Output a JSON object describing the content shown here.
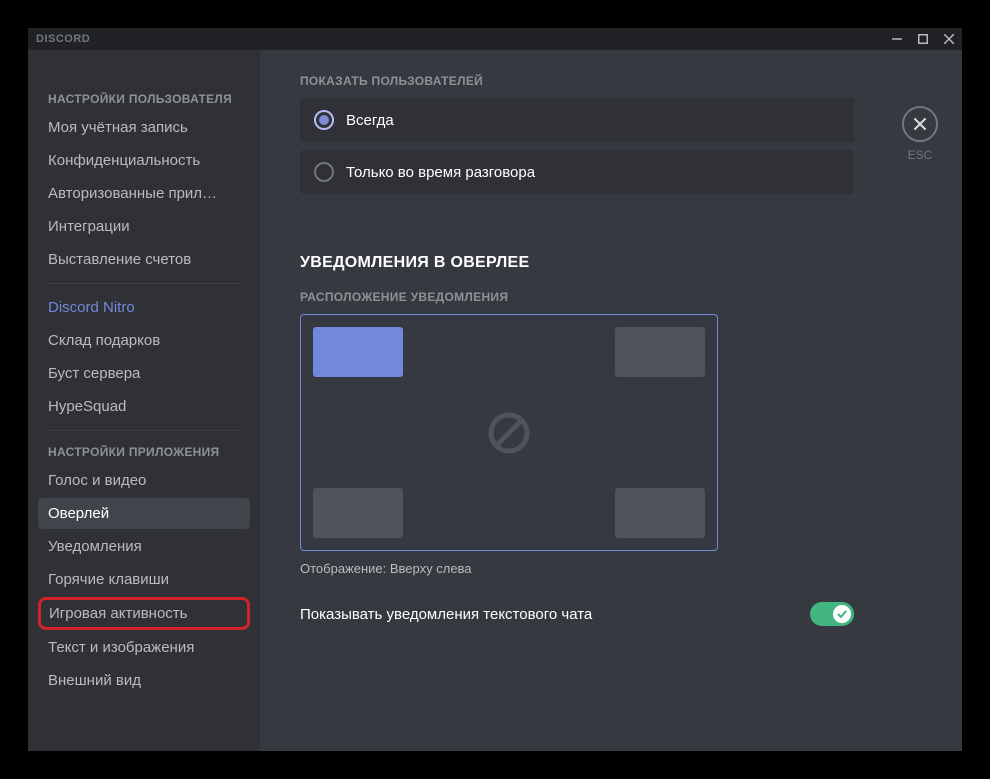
{
  "app": {
    "title": "DISCORD"
  },
  "esc": {
    "label": "ESC"
  },
  "sidebar": {
    "section_user": "НАСТРОЙКИ ПОЛЬЗОВАТЕЛЯ",
    "items_user": [
      "Моя учётная запись",
      "Конфиденциальность",
      "Авторизованные прил…",
      "Интеграции",
      "Выставление счетов"
    ],
    "nitro": "Discord Nitro",
    "after_nitro": [
      "Склад подарков",
      "Буст сервера",
      "HypeSquad"
    ],
    "section_app": "НАСТРОЙКИ ПРИЛОЖЕНИЯ",
    "items_app": [
      "Голос и видео",
      "Оверлей",
      "Уведомления",
      "Горячие клавиши",
      "Игровая активность",
      "Текст и изображения",
      "Внешний вид"
    ],
    "active": "Оверлей",
    "highlighted": "Игровая активность"
  },
  "main": {
    "show_users_header": "ПОКАЗАТЬ ПОЛЬЗОВАТЕЛЕЙ",
    "radio_always": "Всегда",
    "radio_talking": "Только во время разговора",
    "overlay_notify_title": "УВЕДОМЛЕНИЯ В ОВЕРЛЕЕ",
    "position_header": "РАСПОЛОЖЕНИЕ УВЕДОМЛЕНИЯ",
    "position_caption": "Отображение: Вверху слева",
    "text_toggle_label": "Показывать уведомления текстового чата",
    "text_toggle_on": true,
    "selected_corner": "tl"
  }
}
